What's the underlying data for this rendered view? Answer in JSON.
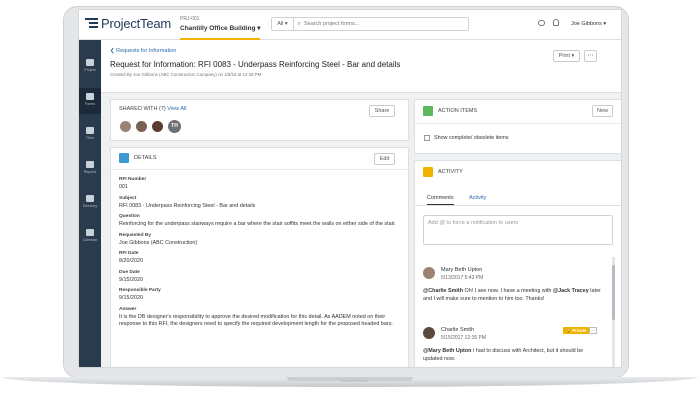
{
  "app": {
    "logo_text": "ProjectTeam",
    "logo_base_text": "PROJECTTEAM"
  },
  "project": {
    "id": "PRJ-001",
    "name": "Chantilly Office Building ▾"
  },
  "search": {
    "filter": "All ▾",
    "placeholder": "Search project forms..."
  },
  "user": {
    "name": "Joe Gibbons ▾"
  },
  "sidebar": {
    "items": [
      {
        "label": "Project",
        "icon": "home-icon"
      },
      {
        "label": "Forms",
        "icon": "forms-icon"
      },
      {
        "label": "Files",
        "icon": "folder-icon"
      },
      {
        "label": "Reports",
        "icon": "reports-icon"
      },
      {
        "label": "Directory",
        "icon": "directory-icon"
      },
      {
        "label": "Calendar",
        "icon": "calendar-icon"
      }
    ]
  },
  "header": {
    "back_link": "❮ Requests for Information",
    "title": "Request for Information: RFI 0083 - Underpass Reinforcing Steel - Bar and details",
    "created": "Created By Joe Gibbons (ABC Construction Company) on 1/8/18 at 12:38 PM",
    "print_label": "Print ▾",
    "more_label": "⋯"
  },
  "shared": {
    "label": "SHARED WITH (7)",
    "view_all": "View All",
    "share_button": "Share",
    "extra_initials": "TH"
  },
  "details": {
    "heading": "DETAILS",
    "edit_button": "Edit",
    "fields": [
      {
        "label": "RFI Number",
        "value": "001"
      },
      {
        "label": "Subject",
        "value": "RFI 0083 - Underpass Reinforcing Steel - Bar and details"
      },
      {
        "label": "Question",
        "value": "Reinforcing for the underpass stairways require a bar where the stair soffits meet the walls on either side of the stair."
      },
      {
        "label": "Requested By",
        "value": "Joe Gibbons (ABC Construction)"
      },
      {
        "label": "RFI Date",
        "value": "8/20/2020"
      },
      {
        "label": "Due Date",
        "value": "9/15/2020"
      },
      {
        "label": "Responsible Party",
        "value": "9/15/2020"
      },
      {
        "label": "Answer",
        "value": "It is the DB designer's responsibility to approve the desired modification for this detail. As AADEM noted on their response to this RFI, the designers need to specify the required development length for the proposed headed bars."
      }
    ]
  },
  "action_items": {
    "heading": "ACTION ITEMS",
    "new_button": "New",
    "checkbox_label": "Show complete/ obsolete items"
  },
  "activity": {
    "heading": "ACTIVITY",
    "tabs": [
      "Comments",
      "Activity"
    ],
    "comment_placeholder": "Add @ to force a notification to users",
    "comments": [
      {
        "name": "Mary Beth Upton",
        "date": "5/13/2017 5:43 PM",
        "mention": "@Charlie Smith",
        "text_a": " Oh! I see now. I have a meeting with ",
        "mention2": "@Jack Tracey",
        "text_b": " later and I will make sure to mention to him too. Thanks!"
      },
      {
        "name": "Charlie Smith",
        "date": "5/15/2017 12:35 PM",
        "badge": "🔒 Private",
        "more": "⋯",
        "mention": "@Mary Beth Upton",
        "text_a": " I had to discuss with Architect, but it should be updated now."
      }
    ]
  },
  "colors": {
    "accent": "#f0b400",
    "brand": "#1f3a5a",
    "sidebar": "#2b3b4e",
    "details_icon": "#3d9ad1",
    "action_icon": "#5cb85c",
    "activity_icon": "#f0b400"
  }
}
